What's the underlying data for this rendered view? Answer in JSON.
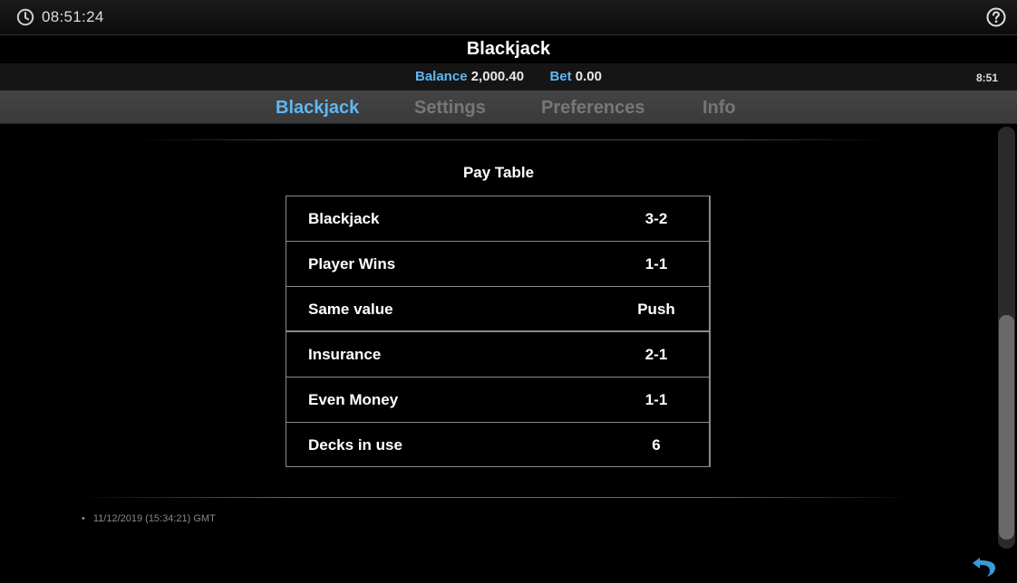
{
  "header": {
    "clock_icon": "clock-icon",
    "time": "08:51:24",
    "help_icon": "question-circle-icon"
  },
  "game": {
    "title": "Blackjack",
    "balance_label": "Balance",
    "balance_value": "2,000.40",
    "bet_label": "Bet",
    "bet_value": "0.00",
    "short_time": "8:51"
  },
  "tabs": [
    {
      "label": "Blackjack",
      "active": true
    },
    {
      "label": "Settings",
      "active": false
    },
    {
      "label": "Preferences",
      "active": false
    },
    {
      "label": "Info",
      "active": false
    }
  ],
  "pay_table": {
    "title": "Pay Table",
    "rows": [
      {
        "label": "Blackjack",
        "value": "3-2"
      },
      {
        "label": "Player Wins",
        "value": "1-1"
      },
      {
        "label": "Same value",
        "value": "Push"
      },
      {
        "label": "Insurance",
        "value": "2-1"
      },
      {
        "label": "Even Money",
        "value": "1-1"
      },
      {
        "label": "Decks in use",
        "value": "6"
      }
    ]
  },
  "footer": {
    "timestamp": "11/12/2019 (15:34:21) GMT",
    "back_icon": "undo-arrow-icon"
  },
  "colors": {
    "accent": "#5fb7f2",
    "background": "#000000",
    "inactive_tab": "#777777"
  }
}
